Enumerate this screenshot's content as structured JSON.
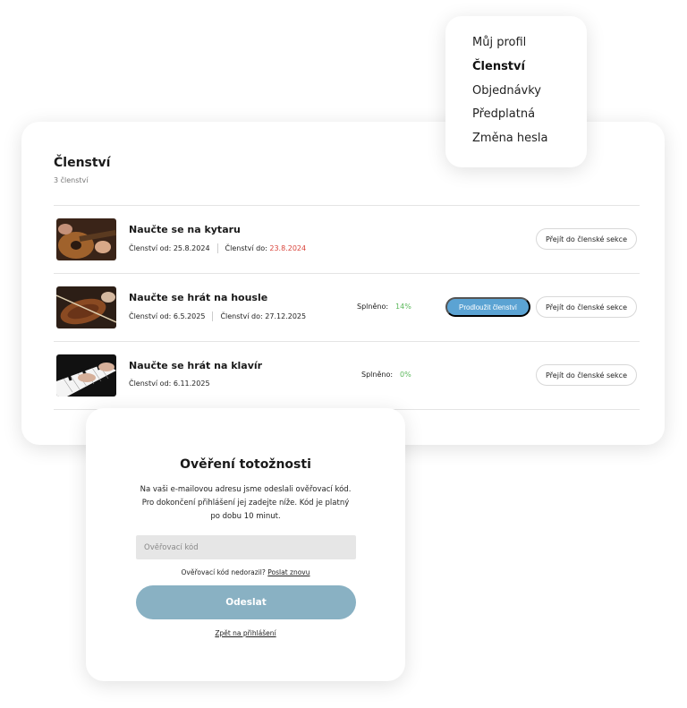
{
  "menu": {
    "items": [
      {
        "label": "Můj profil",
        "active": false
      },
      {
        "label": "Členství",
        "active": true
      },
      {
        "label": "Objednávky",
        "active": false
      },
      {
        "label": "Předplatná",
        "active": false
      },
      {
        "label": "Změna hesla",
        "active": false
      }
    ]
  },
  "membership": {
    "title": "Členství",
    "count": "3 členství",
    "rows": [
      {
        "name": "Naučte se na kytaru",
        "from_label": "Členství od:",
        "from": "25.8.2024",
        "to_label": "Členství do:",
        "to": "23.8.2024",
        "to_color": "#d9443b",
        "progress_label": "",
        "progress_value": "",
        "extend_label": "",
        "section_label": "Přejít do členské sekce"
      },
      {
        "name": "Naučte se hrát na housle",
        "from_label": "Členství od:",
        "from": "6.5.2025",
        "to_label": "Členství do:",
        "to": "27.12.2025",
        "progress_label": "Splněno:",
        "progress_value": "14%",
        "extend_label": "Prodloužit členství",
        "section_label": "Přejít do členské sekce"
      },
      {
        "name": "Naučte se hrát na klavír",
        "from_label": "Členství od:",
        "from": "6.11.2025",
        "progress_label": "Splněno:",
        "progress_value": "0%",
        "section_label": "Přejít do členské sekce"
      }
    ]
  },
  "verify": {
    "title": "Ověření totožnosti",
    "line1": "Na vaši e-mailovou adresu jsme odeslali ověřovací kód.",
    "line2": "Pro dokončení přihlášení jej zadejte níže. Kód je platný",
    "line3": "po dobu 10 minut.",
    "input_placeholder": "Ověřovací kód",
    "resend_text": "Ověřovací kód nedorazil?",
    "resend_link": "Poslat znovu",
    "submit_label": "Odeslat",
    "back_link": "Zpět na přihlášení"
  },
  "colors": {
    "accent_blue": "#5ba3d3",
    "submit_button": "#89b1c3",
    "progress_green": "#5cb85c",
    "expired_red": "#d9443b"
  }
}
